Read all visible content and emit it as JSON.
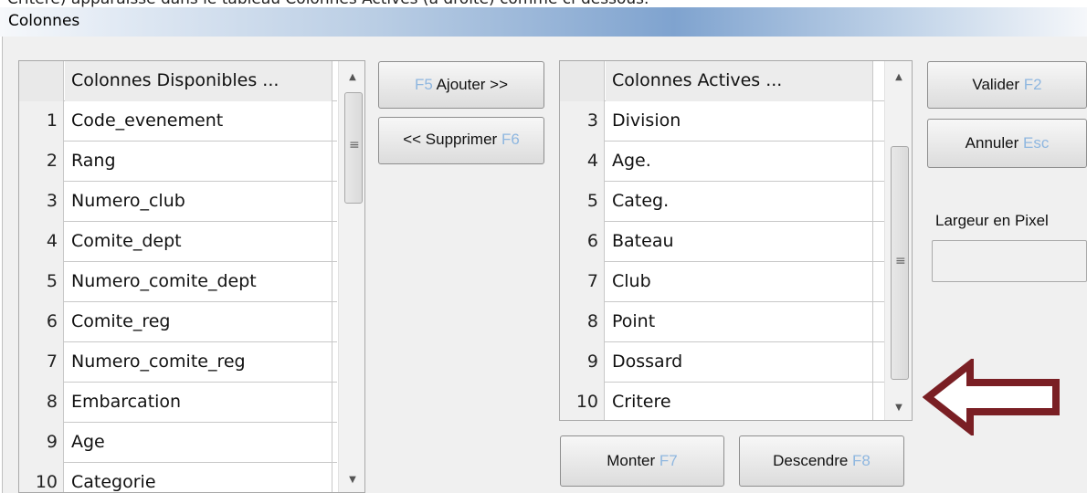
{
  "caption": "Critère) apparaisse dans le tableau Colonnes Actives (à droite) comme ci-dessous.",
  "window": {
    "title": "Colonnes"
  },
  "available": {
    "header": "Colonnes Disponibles ...",
    "rows": [
      {
        "num": "1",
        "name": "Code_evenement"
      },
      {
        "num": "2",
        "name": "Rang"
      },
      {
        "num": "3",
        "name": "Numero_club"
      },
      {
        "num": "4",
        "name": "Comite_dept"
      },
      {
        "num": "5",
        "name": "Numero_comite_dept"
      },
      {
        "num": "6",
        "name": "Comite_reg"
      },
      {
        "num": "7",
        "name": "Numero_comite_reg"
      },
      {
        "num": "8",
        "name": "Embarcation"
      },
      {
        "num": "9",
        "name": "Age"
      },
      {
        "num": "10",
        "name": "Categorie"
      }
    ]
  },
  "active": {
    "header": "Colonnes Actives ...",
    "rows": [
      {
        "num": "3",
        "name": "Division"
      },
      {
        "num": "4",
        "name": "Age."
      },
      {
        "num": "5",
        "name": "Categ."
      },
      {
        "num": "6",
        "name": "Bateau"
      },
      {
        "num": "7",
        "name": "Club"
      },
      {
        "num": "8",
        "name": "Point"
      },
      {
        "num": "9",
        "name": "Dossard"
      },
      {
        "num": "10",
        "name": "Critere"
      }
    ]
  },
  "buttons": {
    "add": {
      "key": "F5",
      "label": " Ajouter >>"
    },
    "remove": {
      "label": "<< Supprimer ",
      "key": "F6"
    },
    "validate": {
      "label": "Valider ",
      "key": "F2"
    },
    "cancel": {
      "label": "Annuler ",
      "key": "Esc"
    },
    "up": {
      "label": "Monter ",
      "key": "F7"
    },
    "down": {
      "label": "Descendre ",
      "key": "F8"
    }
  },
  "width_field": {
    "label": "Largeur en Pixel",
    "value": ""
  },
  "colors": {
    "key_hint": "#8fb7e0",
    "arrow": "#7a1f24"
  },
  "icons": {
    "scroll_up": "triangle-up",
    "scroll_down": "triangle-down",
    "scroll_grip": "grip-lines",
    "pointer": "left-arrow-outline"
  }
}
